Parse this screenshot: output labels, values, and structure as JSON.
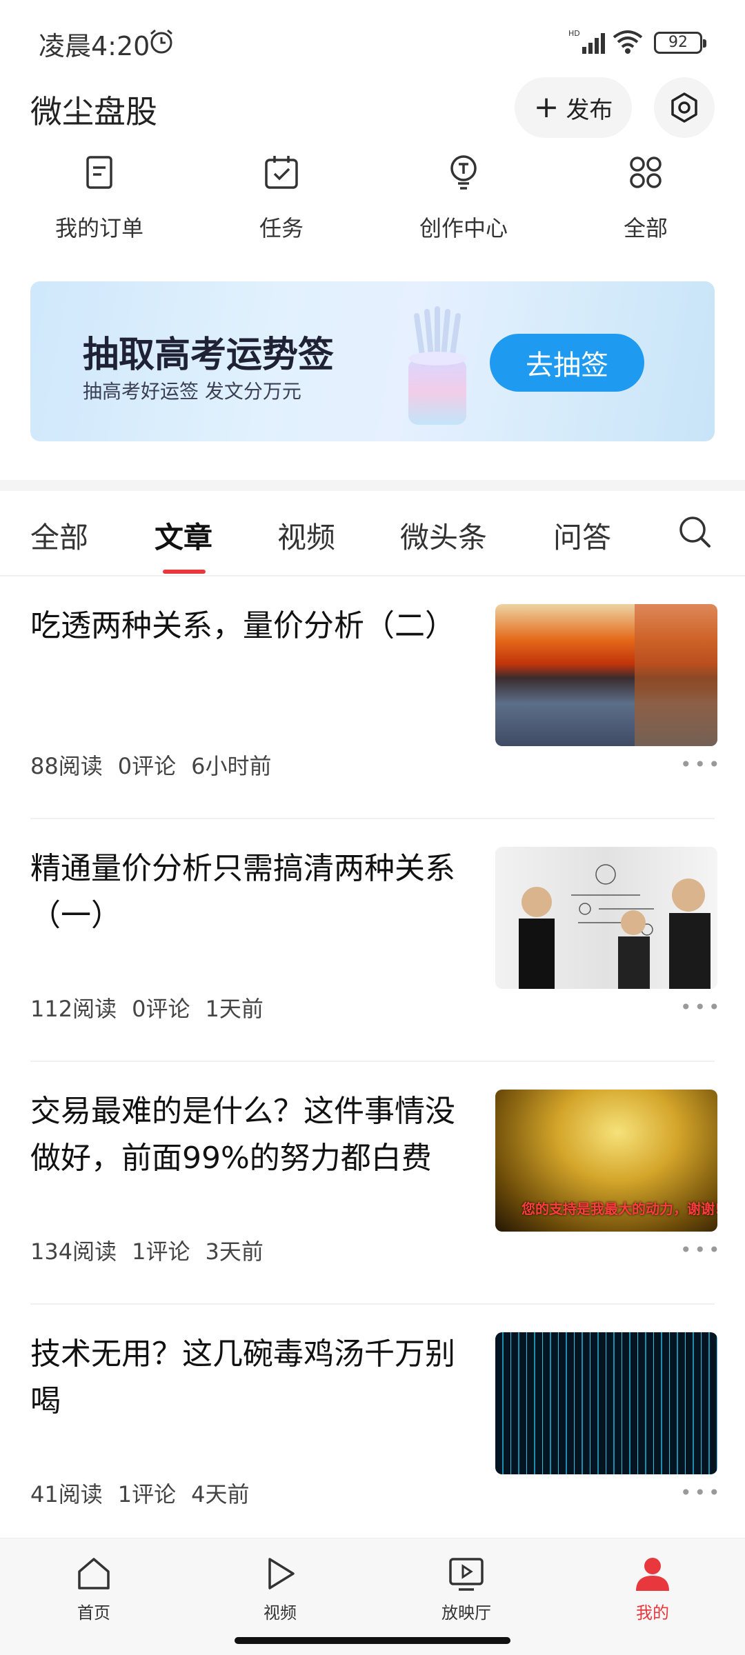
{
  "status_bar": {
    "time": "凌晨4:20",
    "network": "HD",
    "battery": "92"
  },
  "header": {
    "title": "微尘盘股",
    "publish_label": "发布"
  },
  "quick_actions": [
    {
      "label": "我的订单",
      "icon": "order-icon"
    },
    {
      "label": "任务",
      "icon": "calendar-check-icon"
    },
    {
      "label": "创作中心",
      "icon": "lightbulb-icon"
    },
    {
      "label": "全部",
      "icon": "grid-icon"
    }
  ],
  "banner": {
    "title": "抽取高考运势签",
    "subtitle": "抽高考好运签 发文分万元",
    "button_label": "去抽签"
  },
  "tabs": [
    "全部",
    "文章",
    "视频",
    "微头条",
    "问答"
  ],
  "active_tab": "文章",
  "articles": [
    {
      "title": "吃透两种关系，量价分析（二）",
      "reads": "88阅读",
      "comments": "0评论",
      "time": "6小时前",
      "thumb": "autumn-lake"
    },
    {
      "title": "精通量价分析只需搞清两种关系（一）",
      "reads": "112阅读",
      "comments": "0评论",
      "time": "1天前",
      "thumb": "business-people"
    },
    {
      "title": "交易最难的是什么？这件事情没做好，前面99%的努力都白费",
      "reads": "134阅读",
      "comments": "1评论",
      "time": "3天前",
      "thumb": "gold-sparkles",
      "thumb_caption": "您的支持是我最大的动力，谢谢!"
    },
    {
      "title": "技术无用？这几碗毒鸡汤千万别喝",
      "reads": "41阅读",
      "comments": "1评论",
      "time": "4天前",
      "thumb": "digital-rain"
    }
  ],
  "bottom_nav": [
    {
      "label": "首页",
      "icon": "home-icon"
    },
    {
      "label": "视频",
      "icon": "play-icon"
    },
    {
      "label": "放映厅",
      "icon": "tv-play-icon"
    },
    {
      "label": "我的",
      "icon": "person-icon"
    }
  ],
  "colors": {
    "accent": "#e8383d",
    "banner_button": "#1f9af1"
  }
}
